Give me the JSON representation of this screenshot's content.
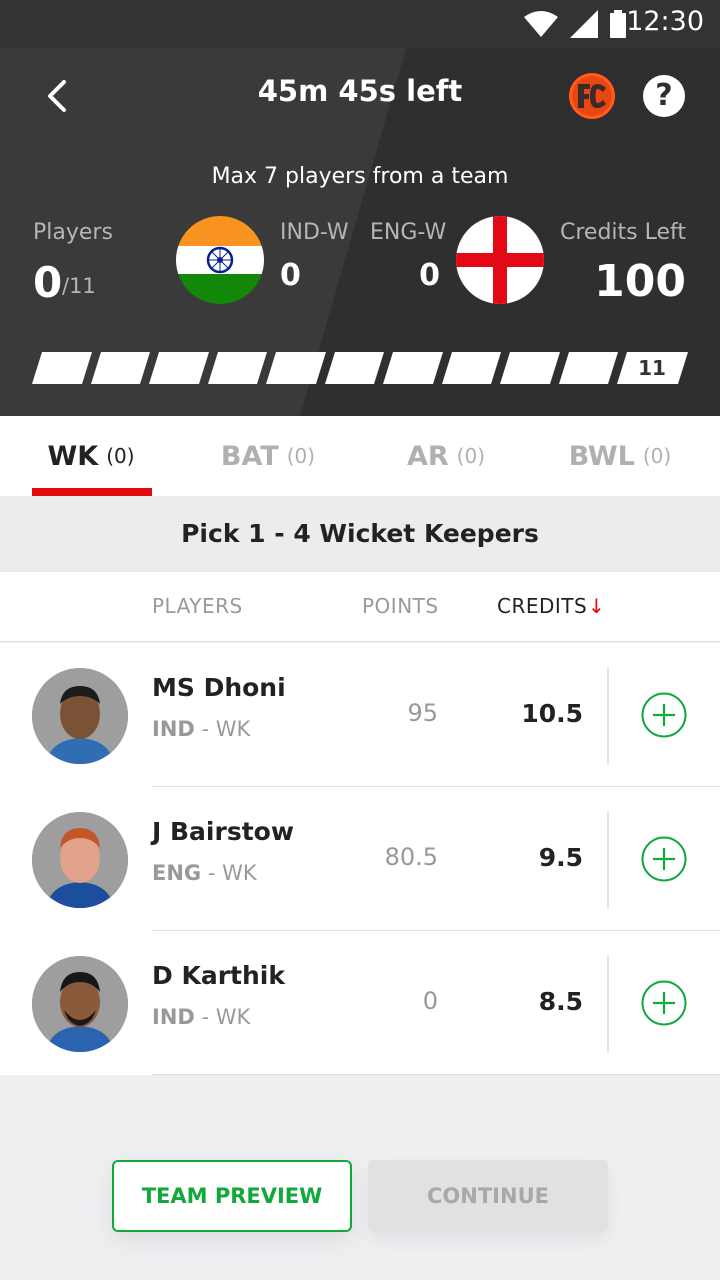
{
  "status": {
    "time": "12:30"
  },
  "header": {
    "timer": "45m 45s left",
    "max_note": "Max 7 players from a team",
    "players_label": "Players",
    "players_count": "0",
    "players_total": "/11",
    "team1": {
      "name": "IND-W",
      "count": "0"
    },
    "team2": {
      "name": "ENG-W",
      "count": "0"
    },
    "credits_label": "Credits Left",
    "credits_value": "100",
    "progress": {
      "selected": 0,
      "total_label": "11"
    },
    "help_label": "?"
  },
  "tabs": [
    {
      "label": "WK",
      "count": "(0)"
    },
    {
      "label": "BAT",
      "count": "(0)"
    },
    {
      "label": "AR",
      "count": "(0)"
    },
    {
      "label": "BWL",
      "count": "(0)"
    }
  ],
  "pick_banner": "Pick 1 - 4 Wicket Keepers",
  "columns": {
    "players": "PLAYERS",
    "points": "POINTS",
    "credits": "CREDITS",
    "sort_arrow": "↓"
  },
  "players": [
    {
      "name": "MS Dhoni",
      "team": "IND",
      "role": "- WK",
      "points": "95",
      "credits": "10.5"
    },
    {
      "name": "J Bairstow",
      "team": "ENG",
      "role": "- WK",
      "points": "80.5",
      "credits": "9.5"
    },
    {
      "name": "D Karthik",
      "team": "IND",
      "role": "- WK",
      "points": "0",
      "credits": "8.5"
    }
  ],
  "buttons": {
    "team_preview": "TEAM PREVIEW",
    "continue": "CONTINUE"
  },
  "colors": {
    "accent_red": "#e10a0a",
    "accent_green": "#12a83c",
    "header_bg": "#3a3a3a"
  }
}
